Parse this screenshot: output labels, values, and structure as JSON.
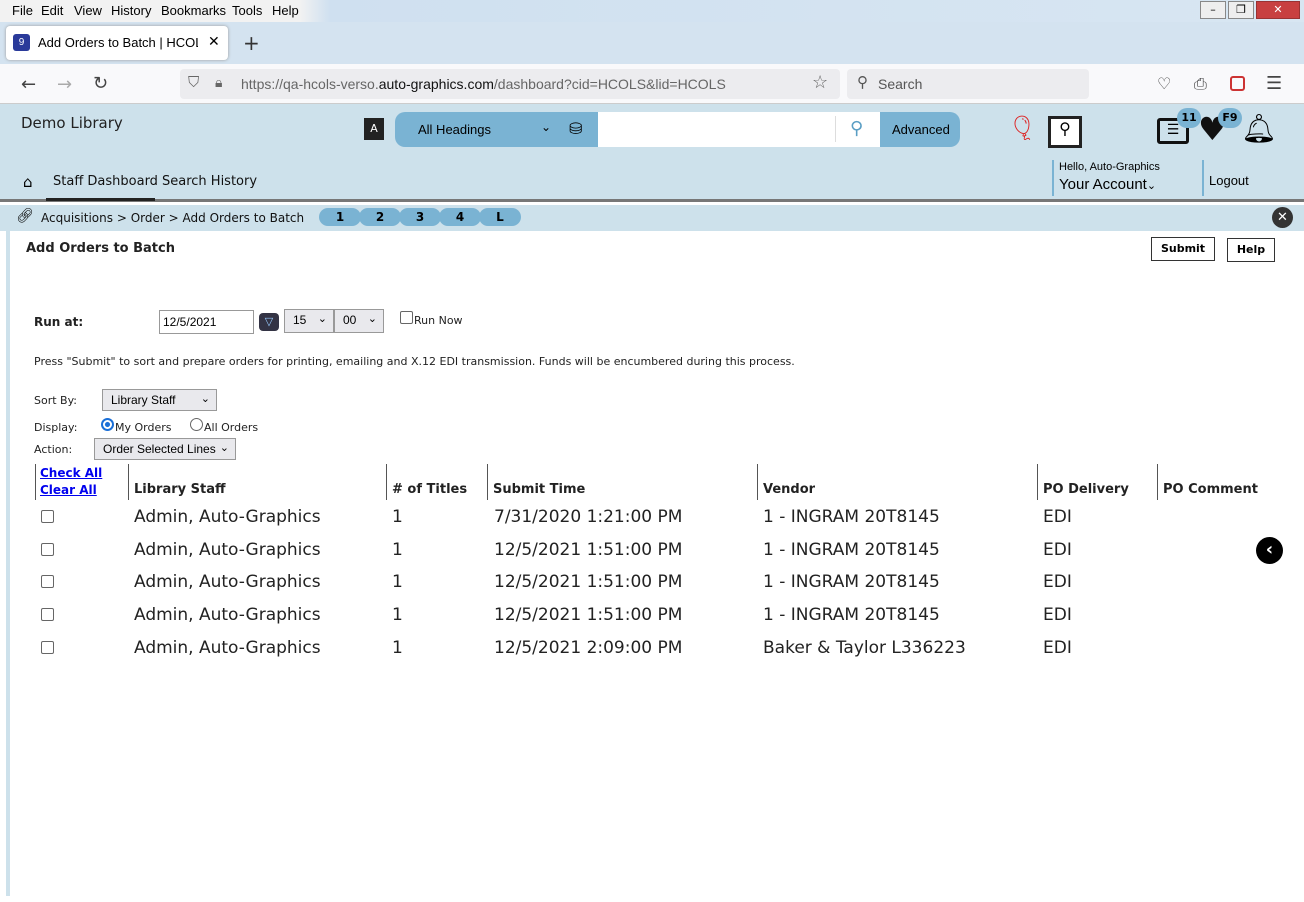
{
  "browser": {
    "menu": [
      "File",
      "Edit",
      "View",
      "History",
      "Bookmarks",
      "Tools",
      "Help"
    ],
    "tab_title": "Add Orders to Batch | HCOLS | H",
    "url_prefix": "https://qa-hcols-verso.",
    "url_domain": "auto-graphics.com",
    "url_suffix": "/dashboard?cid=HCOLS&lid=HCOLS",
    "search_placeholder": "Search"
  },
  "header": {
    "library_name": "Demo Library",
    "search_scope": "All Headings",
    "search_value": "",
    "advanced_label": "Advanced",
    "list_badge": "11",
    "favorites_badge": "F9",
    "greeting": "Hello, Auto-Graphics",
    "account_label": "Your Account",
    "logout_label": "Logout",
    "nav": [
      "Staff Dashboard",
      "Search History"
    ]
  },
  "breadcrumb": {
    "items": [
      "Acquisitions",
      "Order",
      "Add Orders to Batch"
    ],
    "separator": ">",
    "steps": [
      "1",
      "2",
      "3",
      "4",
      "L"
    ]
  },
  "page": {
    "title": "Add Orders to Batch",
    "submit_label": "Submit",
    "help_label": "Help",
    "run_at_label": "Run at:",
    "run_date": "12/5/2021",
    "hour": "15",
    "minute": "00",
    "run_now_label": "Run Now",
    "run_now_checked": false,
    "instructions": "Press \"Submit\" to sort and prepare orders for printing, emailing and X.12 EDI transmission. Funds will be encumbered during this process.",
    "sort_by_label": "Sort By:",
    "sort_by_value": "Library Staff",
    "display_label": "Display:",
    "display_options": [
      "My Orders",
      "All Orders"
    ],
    "display_selected": "My Orders",
    "action_label": "Action:",
    "action_value": "Order Selected Lines",
    "check_all": "Check All",
    "clear_all": "Clear All"
  },
  "table": {
    "columns": [
      "Library Staff",
      "# of Titles",
      "Submit Time",
      "Vendor",
      "PO Delivery",
      "PO Comment"
    ],
    "rows": [
      {
        "staff": "Admin, Auto-Graphics",
        "titles": "1",
        "submit_time": "7/31/2020 1:21:00 PM",
        "vendor": "1 - INGRAM 20T8145",
        "delivery": "EDI",
        "comment": ""
      },
      {
        "staff": "Admin, Auto-Graphics",
        "titles": "1",
        "submit_time": "12/5/2021 1:51:00 PM",
        "vendor": "1 - INGRAM 20T8145",
        "delivery": "EDI",
        "comment": ""
      },
      {
        "staff": "Admin, Auto-Graphics",
        "titles": "1",
        "submit_time": "12/5/2021 1:51:00 PM",
        "vendor": "1 - INGRAM 20T8145",
        "delivery": "EDI",
        "comment": ""
      },
      {
        "staff": "Admin, Auto-Graphics",
        "titles": "1",
        "submit_time": "12/5/2021 1:51:00 PM",
        "vendor": "1 - INGRAM 20T8145",
        "delivery": "EDI",
        "comment": ""
      },
      {
        "staff": "Admin, Auto-Graphics",
        "titles": "1",
        "submit_time": "12/5/2021 2:09:00 PM",
        "vendor": "Baker & Taylor L336223",
        "delivery": "EDI",
        "comment": ""
      }
    ]
  }
}
